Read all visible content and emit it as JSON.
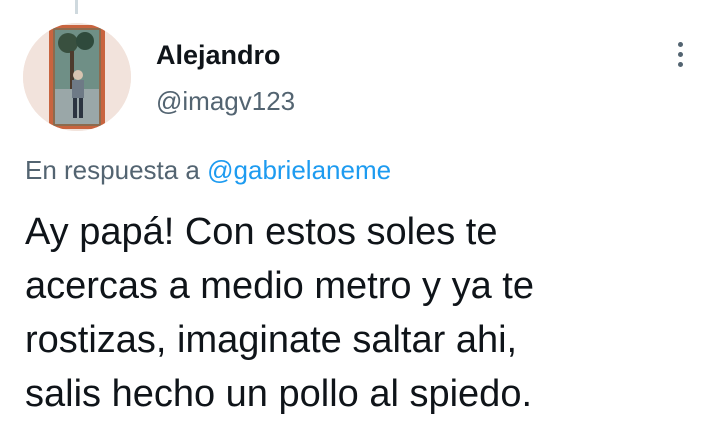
{
  "tweet": {
    "author_name": "Alejandro",
    "author_handle": "@imagv123",
    "reply_prefix": "En respuesta a",
    "reply_to_handle": "@gabrielaneme",
    "text": "Ay papá! Con estos soles te\nacercas a medio metro y ya te\nrostizas, imaginate saltar ahi,\nsalis hecho un pollo al spiedo."
  },
  "icons": {
    "more": "more-vertical-icon"
  },
  "colors": {
    "primary_text": "#0f1419",
    "secondary_text": "#536471",
    "link": "#1d9bf0",
    "thread_line": "#cfd9de"
  }
}
